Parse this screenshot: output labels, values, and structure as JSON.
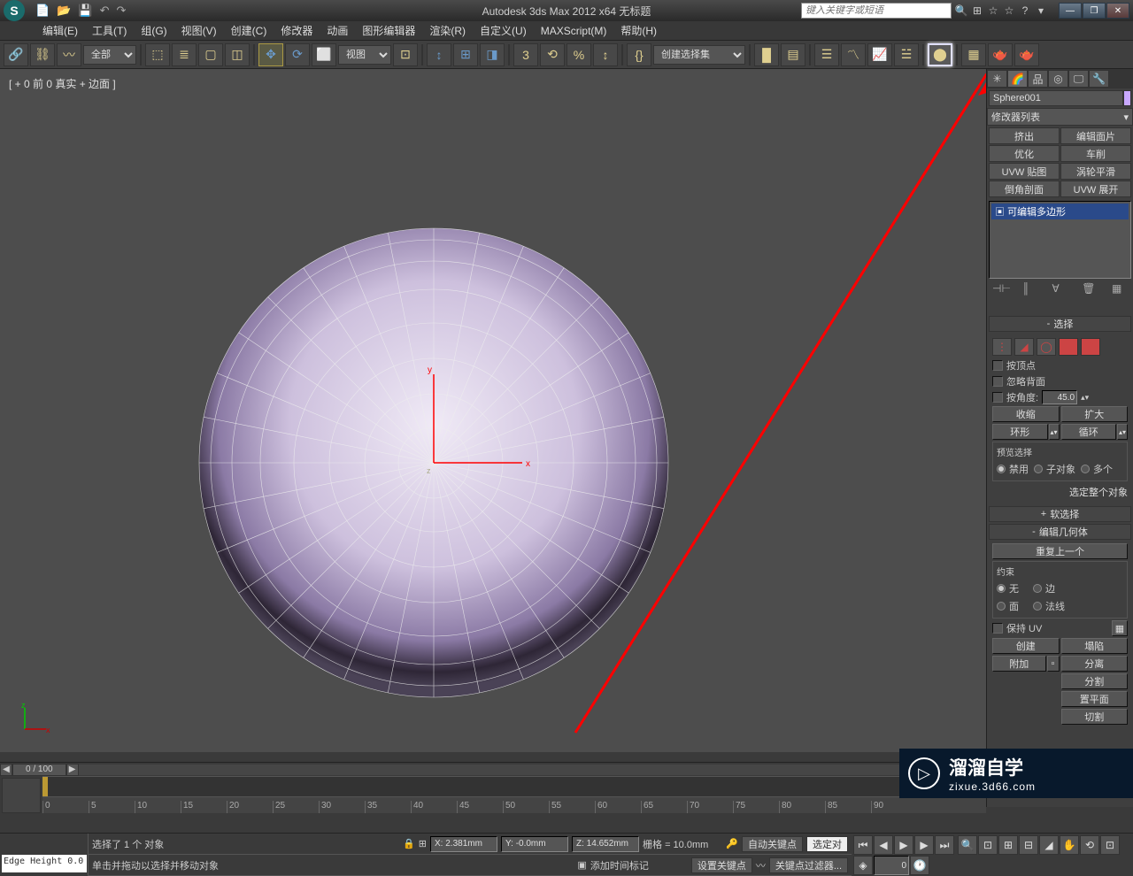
{
  "title": "Autodesk 3ds Max 2012 x64   无标题",
  "search_placeholder": "键入关键字或短语",
  "menu": [
    "编辑(E)",
    "工具(T)",
    "组(G)",
    "视图(V)",
    "创建(C)",
    "修改器",
    "动画",
    "图形编辑器",
    "渲染(R)",
    "自定义(U)",
    "MAXScript(M)",
    "帮助(H)"
  ],
  "toolbar": {
    "filter_all": "全部",
    "view_dropdown": "视图",
    "selset_dropdown": "创建选择集"
  },
  "viewport": {
    "label": "[ + 0 前 0 真实 + 边面 ]",
    "axis_x": "x",
    "axis_y": "y",
    "axis_z": "z"
  },
  "panel": {
    "obj_name": "Sphere001",
    "modifier_list": "修改器列表",
    "mod_buttons": [
      "挤出",
      "编辑面片",
      "优化",
      "车削",
      "UVW 贴图",
      "涡轮平滑",
      "倒角剖面",
      "UVW 展开"
    ],
    "stack_item": "可编辑多边形",
    "rollouts": {
      "selection": "选择",
      "soft_sel": "软选择",
      "edit_geom": "编辑几何体"
    },
    "sel": {
      "by_vertex": "按顶点",
      "ignore_back": "忽略背面",
      "by_angle": "按角度:",
      "angle_val": "45.0",
      "shrink": "收缩",
      "grow": "扩大",
      "ring": "环形",
      "loop": "循环",
      "preview": "预览选择",
      "disabled": "禁用",
      "subobj": "子对象",
      "multi": "多个",
      "select_all": "选定整个对象"
    },
    "geo": {
      "repeat": "重复上一个",
      "constraint": "约束",
      "none": "无",
      "edge": "边",
      "face": "面",
      "normal": "法线",
      "preserve_uv": "保持 UV",
      "create": "创建",
      "collapse": "塌陷",
      "attach": "附加",
      "detach": "分离",
      "split": "分割",
      "plane": "置平面",
      "cut": "切割"
    }
  },
  "timeline": {
    "frame": "0 / 100",
    "ticks": [
      "0",
      "5",
      "10",
      "15",
      "20",
      "25",
      "30",
      "35",
      "40",
      "45",
      "50",
      "55",
      "60",
      "65",
      "70",
      "75",
      "80",
      "85",
      "90"
    ]
  },
  "status": {
    "edge_height": "Edge Height 0.0",
    "selected": "选择了 1 个 对象",
    "hint": "单击并拖动以选择并移动对象",
    "x": "X: 2.381mm",
    "y": "Y: -0.0mm",
    "z": "Z: 14.652mm",
    "grid": "栅格 = 10.0mm",
    "autokey": "自动关键点",
    "sel_filter": "选定对",
    "setkey": "设置关键点",
    "keyfilter": "关键点过滤器...",
    "add_time": "添加时间标记",
    "frame_num": "0"
  },
  "watermark": {
    "title": "溜溜自学",
    "sub": "zixue.3d66.com"
  }
}
